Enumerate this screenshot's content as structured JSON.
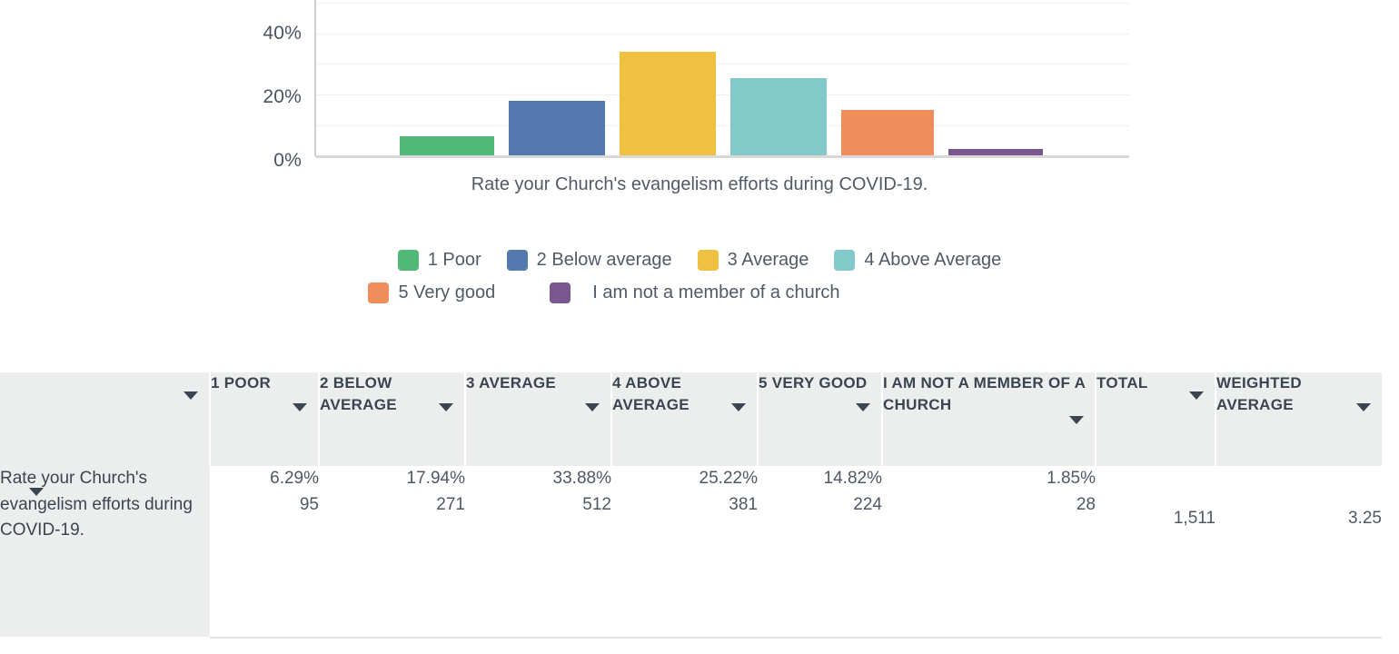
{
  "chart_data": {
    "type": "bar",
    "title": "",
    "xlabel": "Rate your Church's evangelism efforts during COVID-19.",
    "ylabel": "",
    "categories": [
      "1 Poor",
      "2 Below average",
      "3 Average",
      "4 Above Average",
      "5 Very good",
      "I am not a member of a church"
    ],
    "values": [
      6.29,
      17.94,
      33.88,
      25.22,
      14.82,
      1.85
    ],
    "counts": [
      95,
      271,
      512,
      381,
      224,
      28
    ],
    "colors": [
      "#52b878",
      "#5479b0",
      "#f0c040",
      "#83c9c9",
      "#ef8e5b",
      "#7a568f"
    ],
    "ylim": [
      0,
      50
    ],
    "yticks": [
      0,
      10,
      20,
      30,
      40,
      50
    ],
    "ytick_labels": [
      "0%",
      "",
      "20%",
      "",
      "40%",
      ""
    ],
    "grid": true,
    "legend_position": "bottom"
  },
  "chart": {
    "y_labels": [
      "40%",
      "20%",
      "0%"
    ],
    "x_axis_title": "Rate your Church's evangelism efforts during COVID-19."
  },
  "legend": {
    "rows": [
      [
        {
          "label": "1 Poor",
          "color": "#52b878"
        },
        {
          "label": "2 Below average",
          "color": "#5479b0"
        },
        {
          "label": "3 Average",
          "color": "#f0c040"
        },
        {
          "label": "4 Above Average",
          "color": "#83c9c9"
        }
      ],
      [
        {
          "label": "5 Very good",
          "color": "#ef8e5b"
        },
        {
          "label": "I am not a member of a church",
          "color": "#7a568f"
        }
      ]
    ]
  },
  "table": {
    "headers": [
      "",
      "1 POOR",
      "2 BELOW AVERAGE",
      "3 AVERAGE",
      "4 ABOVE AVERAGE",
      "5 VERY GOOD",
      "I AM NOT A MEMBER OF A CHURCH",
      "TOTAL",
      "WEIGHTED AVERAGE"
    ],
    "rows": [
      {
        "question": "Rate your Church's evangelism efforts during COVID-19.",
        "cells": [
          {
            "pct": "6.29%",
            "count": "95"
          },
          {
            "pct": "17.94%",
            "count": "271"
          },
          {
            "pct": "33.88%",
            "count": "512"
          },
          {
            "pct": "25.22%",
            "count": "381"
          },
          {
            "pct": "14.82%",
            "count": "224"
          },
          {
            "pct": "1.85%",
            "count": "28"
          }
        ],
        "total": "1,511",
        "weighted_average": "3.25"
      }
    ]
  }
}
